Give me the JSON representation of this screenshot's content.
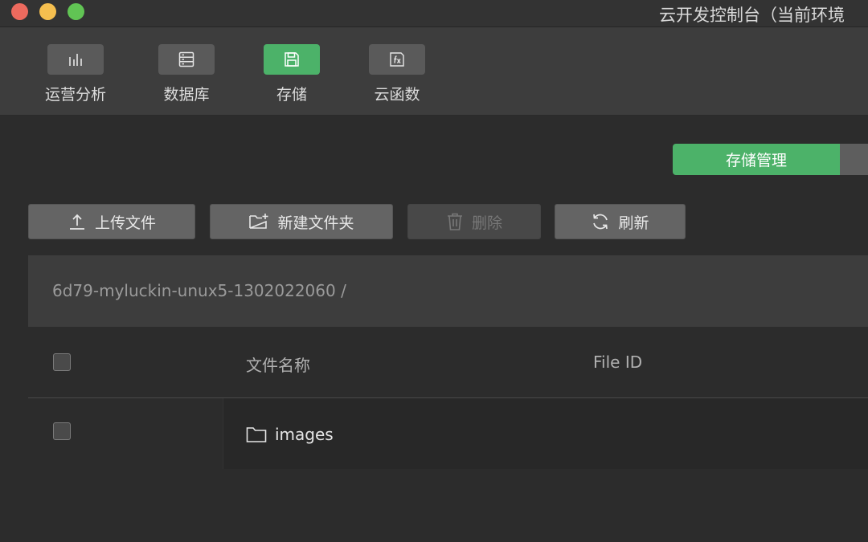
{
  "window": {
    "title": "云开发控制台（当前环境"
  },
  "toolbar": {
    "items": [
      {
        "label": "运营分析",
        "icon": "bar-chart-icon",
        "active": false
      },
      {
        "label": "数据库",
        "icon": "database-icon",
        "active": false
      },
      {
        "label": "存储",
        "icon": "storage-icon",
        "active": true
      },
      {
        "label": "云函数",
        "icon": "function-icon",
        "active": false
      }
    ]
  },
  "tabs": {
    "active_label": "存储管理"
  },
  "actions": {
    "upload": "上传文件",
    "new_folder": "新建文件夹",
    "delete": "删除",
    "refresh": "刷新"
  },
  "breadcrumb": {
    "path": "6d79-myluckin-unux5-1302022060 /"
  },
  "table": {
    "headers": {
      "name": "文件名称",
      "file_id": "File ID"
    },
    "rows": [
      {
        "name": "images",
        "type": "folder"
      }
    ]
  },
  "colors": {
    "accent": "#4cb269",
    "background": "#2c2c2c",
    "toolbar": "#3d3d3d"
  }
}
